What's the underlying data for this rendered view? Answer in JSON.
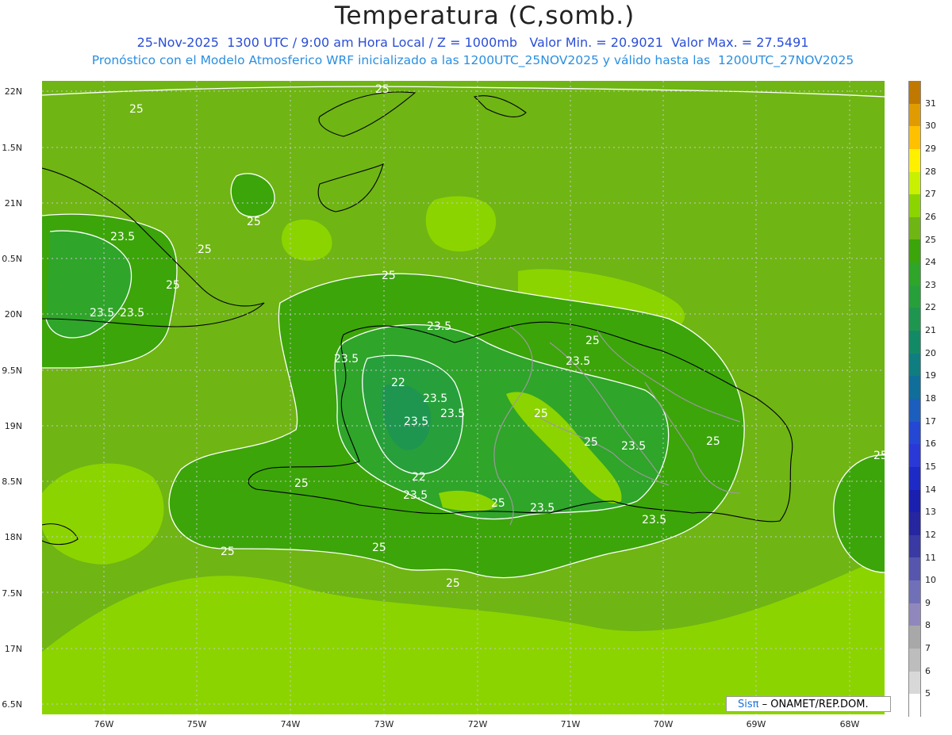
{
  "title": "Temperatura (C,somb.)",
  "subtitle_line1": "25-Nov-2025  1300 UTC / 9:00 am Hora Local / Z = 1000mb   Valor Min. = 20.9021  Valor Max. = 27.5491",
  "subtitle_line2": "Pronóstico con el Modelo Atmosferico WRF inicializado a las 1200UTC_25NOV2025 y válido hasta las  1200UTC_27NOV2025",
  "lat_labels": [
    "22N",
    "1.5N",
    "21N",
    "0.5N",
    "20N",
    "9.5N",
    "19N",
    "8.5N",
    "18N",
    "7.5N",
    "17N",
    "6.5N"
  ],
  "lon_labels": [
    "76W",
    "75W",
    "74W",
    "73W",
    "72W",
    "71W",
    "70W",
    "69W",
    "68W"
  ],
  "contour_labels": [
    "25",
    "25",
    "25",
    "23.5",
    "25",
    "25",
    "23.5",
    "23.5",
    "25",
    "23.5",
    "23.5",
    "25",
    "23.5",
    "22",
    "23.5",
    "23.5",
    "23.5",
    "25",
    "25",
    "23.5",
    "22",
    "23.5",
    "25",
    "23.5",
    "23.5",
    "25",
    "25",
    "25",
    "25",
    "25",
    "25"
  ],
  "colorbar": {
    "labels": [
      "31",
      "30",
      "29",
      "28",
      "27",
      "26",
      "25",
      "24",
      "23",
      "22",
      "21",
      "20",
      "19",
      "18",
      "17",
      "16",
      "15",
      "14",
      "13",
      "12",
      "11",
      "10",
      "9",
      "8",
      "7",
      "6",
      "5"
    ],
    "colors": [
      "#c07800",
      "#e09b00",
      "#ffc000",
      "#fff000",
      "#c8f000",
      "#8cd400",
      "#6fb514",
      "#3ca50a",
      "#2fa52a",
      "#27a03c",
      "#1e9650",
      "#138a66",
      "#0f7e80",
      "#106e9a",
      "#1c5ebe",
      "#2448d4",
      "#2a38d8",
      "#1e2ac6",
      "#1b1fb0",
      "#2626a0",
      "#3a3aa4",
      "#5656ae",
      "#7070b8",
      "#9088bc",
      "#a8a8a8",
      "#bdbdbd",
      "#d8d8d8",
      "#ffffff"
    ]
  },
  "credit": {
    "logo": "Sisπ",
    "text": "– ONAMET/REP.DOM."
  },
  "colors": {
    "title": "#222222",
    "subtitle1": "#2b4ed8",
    "subtitle2": "#2a8fe0"
  }
}
